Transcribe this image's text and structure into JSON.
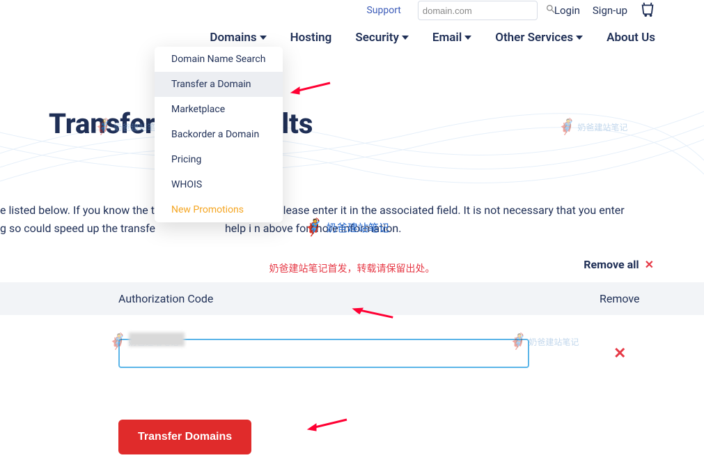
{
  "topbar": {
    "support": "Support",
    "search_placeholder": "domain.com",
    "login": "Login",
    "signup": "Sign-up"
  },
  "nav": {
    "items": [
      {
        "label": "Domains",
        "has_caret": true
      },
      {
        "label": "Hosting",
        "has_caret": false
      },
      {
        "label": "Security",
        "has_caret": true
      },
      {
        "label": "Email",
        "has_caret": true
      },
      {
        "label": "Other Services",
        "has_caret": true
      },
      {
        "label": "About Us",
        "has_caret": false
      }
    ]
  },
  "dropdown": {
    "items": [
      {
        "label": "Domain Name Search"
      },
      {
        "label": "Transfer a Domain",
        "hover": true
      },
      {
        "label": "Marketplace"
      },
      {
        "label": "Backorder a Domain"
      },
      {
        "label": "Pricing"
      },
      {
        "label": "WHOIS"
      },
      {
        "label": "New Promotions",
        "promo": true
      }
    ]
  },
  "page": {
    "title_left": "Transfer",
    "title_right": "esults",
    "body_line1_left": "e listed below. If you know the t",
    "body_line1_right": "e, please enter it in the associated field. It is not necessary that you enter",
    "body_line2_left": "g so could speed up the transfe",
    "body_line2_right": "help i     n above for more information."
  },
  "annotations": {
    "red_text": "奶爸建站笔记首发，转载请保留出处。",
    "watermark": "奶爸建站笔记"
  },
  "actions": {
    "remove_all": "Remove all"
  },
  "table": {
    "auth_header": "Authorization Code",
    "remove_header": "Remove",
    "rows": [
      {
        "auth_value": ""
      }
    ]
  },
  "button": {
    "transfer": "Transfer Domains"
  }
}
